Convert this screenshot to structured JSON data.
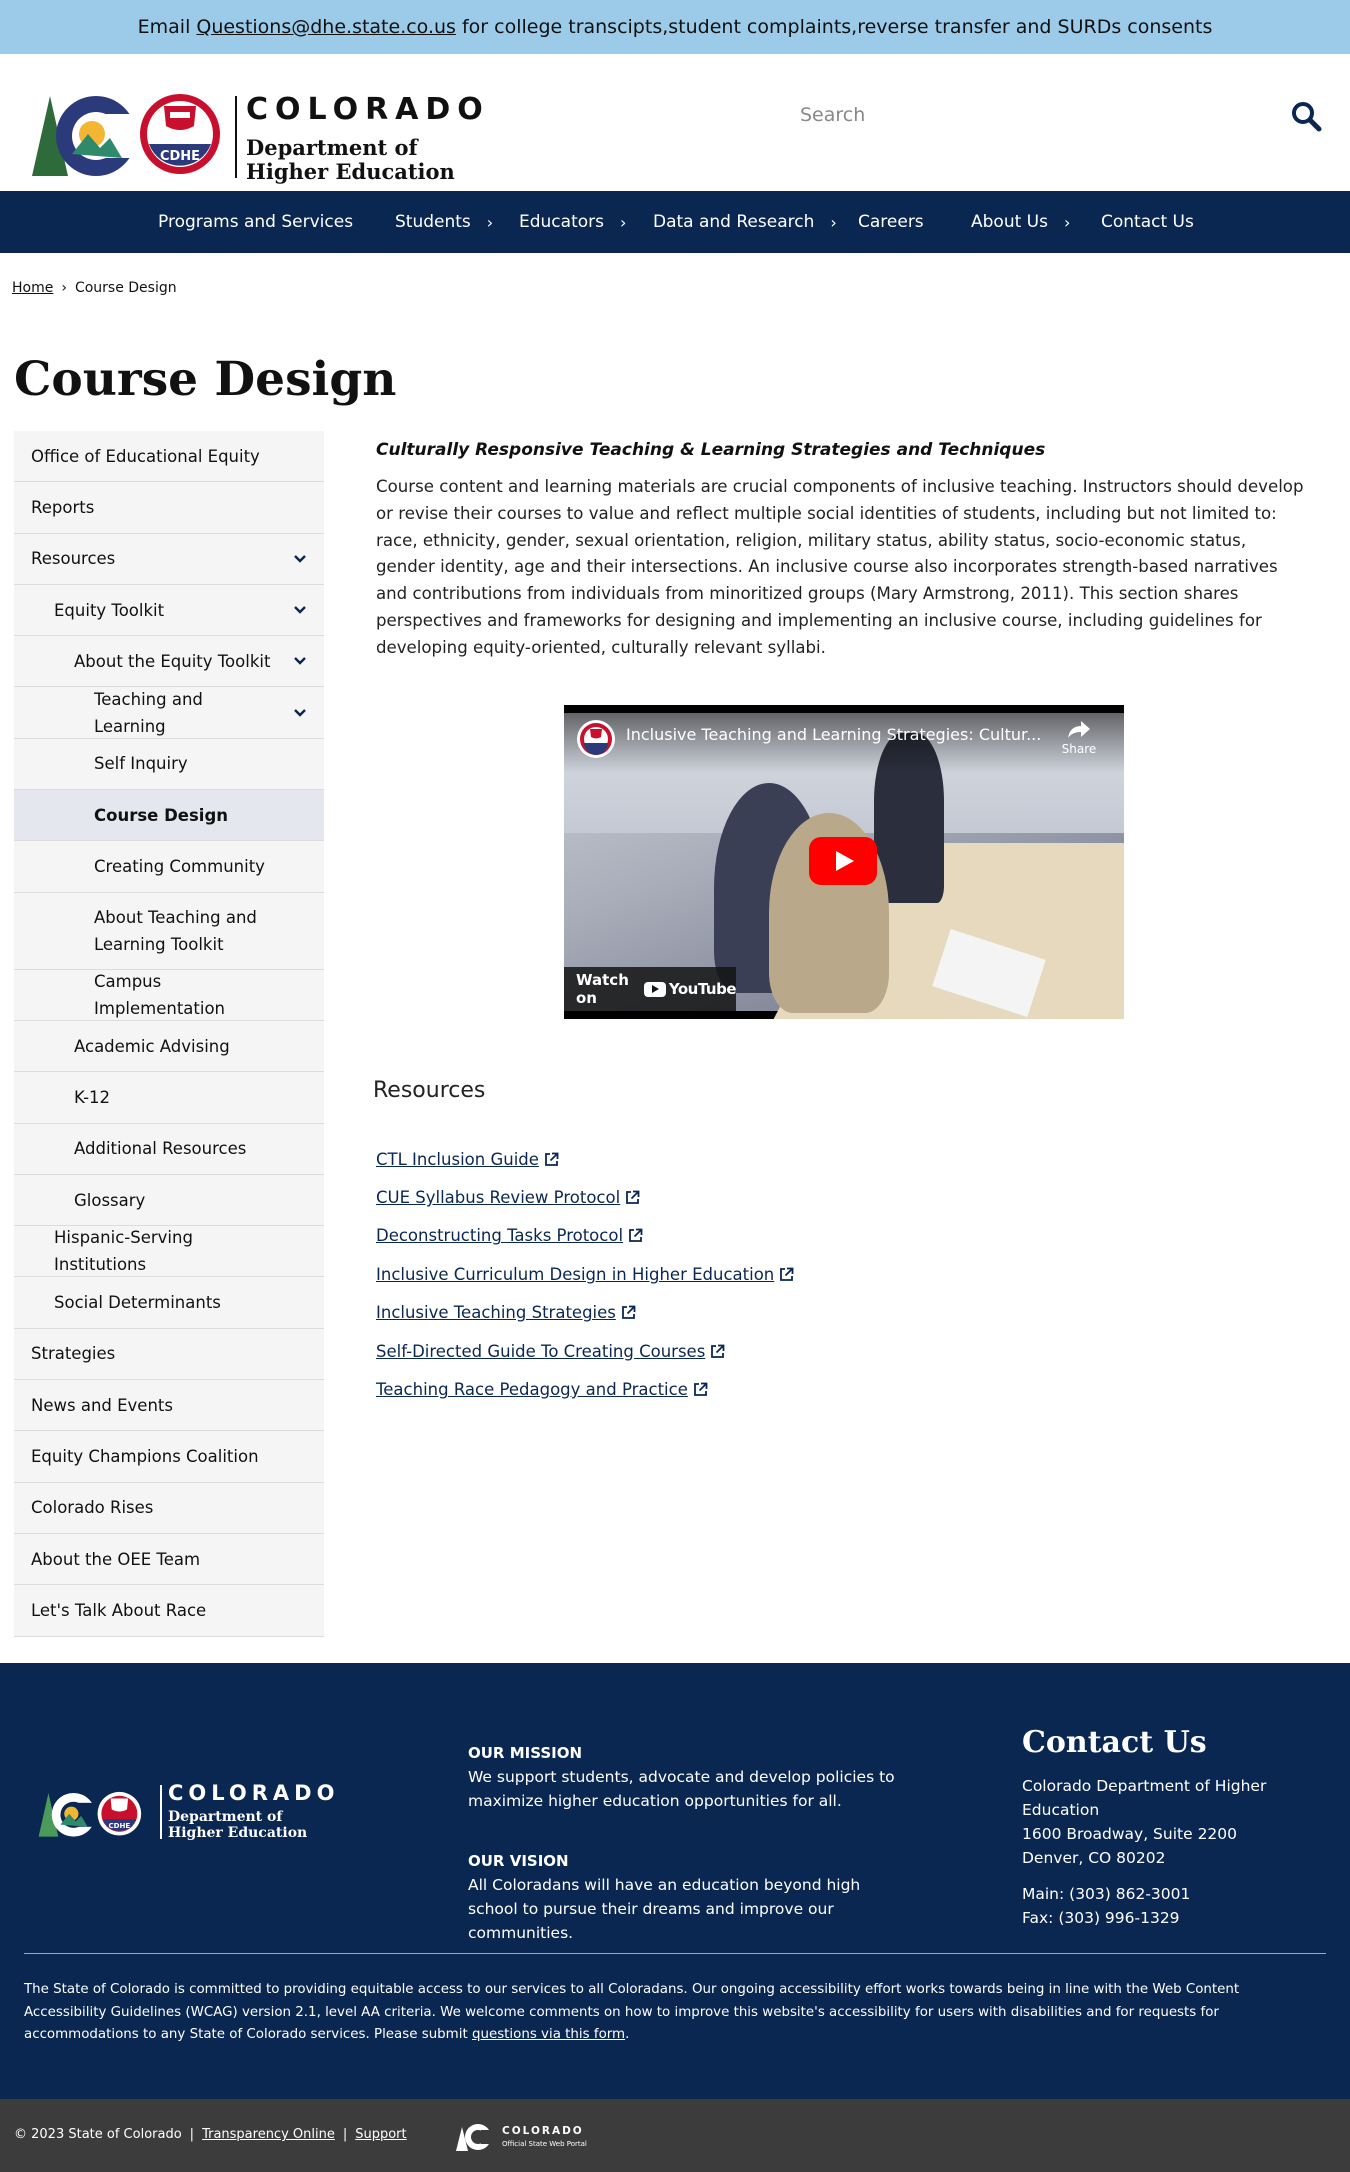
{
  "banner": {
    "prefix": "Email",
    "email": "Questions@dhe.state.co.us",
    "suffix": "for college transcipts,student complaints,reverse transfer and SURDs consents"
  },
  "header": {
    "logo": {
      "wordmark": "COLORADO",
      "line1": "Department of",
      "line2": "Higher Education",
      "badge": "CDHE"
    },
    "search": {
      "placeholder": "Search",
      "value": ""
    },
    "search_icon": "magnifier-icon"
  },
  "nav": {
    "items": [
      {
        "label": "Programs and Services",
        "has_submenu": false
      },
      {
        "label": "Students",
        "has_submenu": true
      },
      {
        "label": "Educators",
        "has_submenu": true
      },
      {
        "label": "Data and Research",
        "has_submenu": true
      },
      {
        "label": "Careers",
        "has_submenu": false
      },
      {
        "label": "About Us",
        "has_submenu": true
      },
      {
        "label": "Contact Us",
        "has_submenu": false
      }
    ],
    "chevron": "›"
  },
  "breadcrumb": {
    "home": "Home",
    "sep": "›",
    "current": "Course Design"
  },
  "page": {
    "title": "Course Design"
  },
  "sidebar": {
    "items": [
      {
        "label": "Office of Educational Equity",
        "level": 0,
        "expanded": false,
        "has_toggle": false
      },
      {
        "label": "Reports",
        "level": 0,
        "has_toggle": false
      },
      {
        "label": "Resources",
        "level": 0,
        "has_toggle": true
      },
      {
        "label": "Equity Toolkit",
        "level": 1,
        "has_toggle": true
      },
      {
        "label": "About the Equity Toolkit",
        "level": 2,
        "has_toggle": true
      },
      {
        "label": "Teaching and Learning",
        "level": 3,
        "has_toggle": true
      },
      {
        "label": "Self Inquiry",
        "level": 3,
        "has_toggle": false
      },
      {
        "label": "Course Design",
        "level": 3,
        "has_toggle": false,
        "active": true
      },
      {
        "label": "Creating Community",
        "level": 3,
        "has_toggle": false
      },
      {
        "label": "About Teaching and Learning Toolkit",
        "level": 3,
        "has_toggle": false,
        "two_line": true
      },
      {
        "label": "Campus Implementation",
        "level": 3,
        "has_toggle": false
      },
      {
        "label": "Academic Advising",
        "level": 2,
        "has_toggle": false
      },
      {
        "label": "K-12",
        "level": 2,
        "has_toggle": false
      },
      {
        "label": "Additional Resources",
        "level": 2,
        "has_toggle": false
      },
      {
        "label": "Glossary",
        "level": 2,
        "has_toggle": false
      },
      {
        "label": "Hispanic-Serving Institutions",
        "level": 1,
        "has_toggle": false
      },
      {
        "label": "Social Determinants",
        "level": 1,
        "has_toggle": false
      },
      {
        "label": "Strategies",
        "level": 0,
        "has_toggle": false
      },
      {
        "label": "News and Events",
        "level": 0,
        "has_toggle": false
      },
      {
        "label": "Equity Champions Coalition",
        "level": 0,
        "has_toggle": false
      },
      {
        "label": "Colorado Rises",
        "level": 0,
        "has_toggle": false
      },
      {
        "label": "About the OEE Team",
        "level": 0,
        "has_toggle": false
      },
      {
        "label": "Let's Talk About Race",
        "level": 0,
        "has_toggle": false
      }
    ],
    "toggle_glyph": "chevron-down-icon"
  },
  "content": {
    "lead_title": "Culturally Responsive Teaching & Learning Strategies and Techniques",
    "lead_text": "Course content and learning materials are crucial components of inclusive teaching. Instructors should develop or revise their courses to value and reflect multiple social identities of students, including but not limited to: race, ethnicity, gender, sexual orientation, religion, military status, ability status, socio-economic status, gender identity, age and their intersections. An inclusive course also incorporates strength-based narratives and contributions from individuals from minoritized groups (Mary Armstrong, 2011). This section shares perspectives and frameworks for designing and implementing an inclusive course, including guidelines for developing equity-oriented, culturally relevant syllabi.",
    "video": {
      "title": "Inclusive Teaching and Learning Strategies: Cultur...",
      "share_label": "Share",
      "watch_on": "Watch on",
      "platform": "YouTube"
    },
    "resources_heading": "Resources",
    "resources": [
      "CTL Inclusion Guide",
      "CUE Syllabus Review Protocol",
      "Deconstructing Tasks Protocol",
      "Inclusive Curriculum Design in Higher Education",
      "Inclusive Teaching Strategies",
      "Self-Directed Guide To Creating Courses",
      "Teaching Race Pedagogy and Practice"
    ]
  },
  "footer": {
    "logo": {
      "wordmark": "COLORADO",
      "line1": "Department of",
      "line2": "Higher Education",
      "badge": "CDHE"
    },
    "mission_title": "OUR MISSION",
    "mission_text": "We support students, advocate and develop policies to maximize higher education opportunities for all.",
    "vision_title": "OUR VISION",
    "vision_text": "All Coloradans will have an education beyond high school to pursue their dreams and improve our communities.",
    "contact_title": "Contact Us",
    "contact_org": "Colorado Department of Higher Education",
    "contact_street": "1600 Broadway, Suite 2200",
    "contact_city": "Denver, CO 80202",
    "contact_main": "Main: (303) 862-3001",
    "contact_fax": "Fax: (303) 996-1329",
    "accessibility_text": "The State of Colorado is committed to providing equitable access to our services to all Coloradans. Our ongoing accessibility effort works towards being in line with the Web Content Accessibility Guidelines (WCAG) version 2.1, level AA criteria. We welcome comments on how to improve this website's accessibility for users with disabilities and for requests for accommodations to any State of Colorado services. Please submit",
    "accessibility_link": "questions via this form",
    "accessibility_end": "."
  },
  "bottom_bar": {
    "copyright": "© 2023 State of Colorado",
    "sep": "|",
    "transparency": "Transparency Online",
    "support": "Support",
    "portal_word": "COLORADO",
    "portal_sub": "Official State Web Portal"
  },
  "colors": {
    "navy": "#0a2752",
    "banner": "#9ccbe9",
    "bottom": "#3c3c3c",
    "youtube_red": "#ff0000"
  }
}
